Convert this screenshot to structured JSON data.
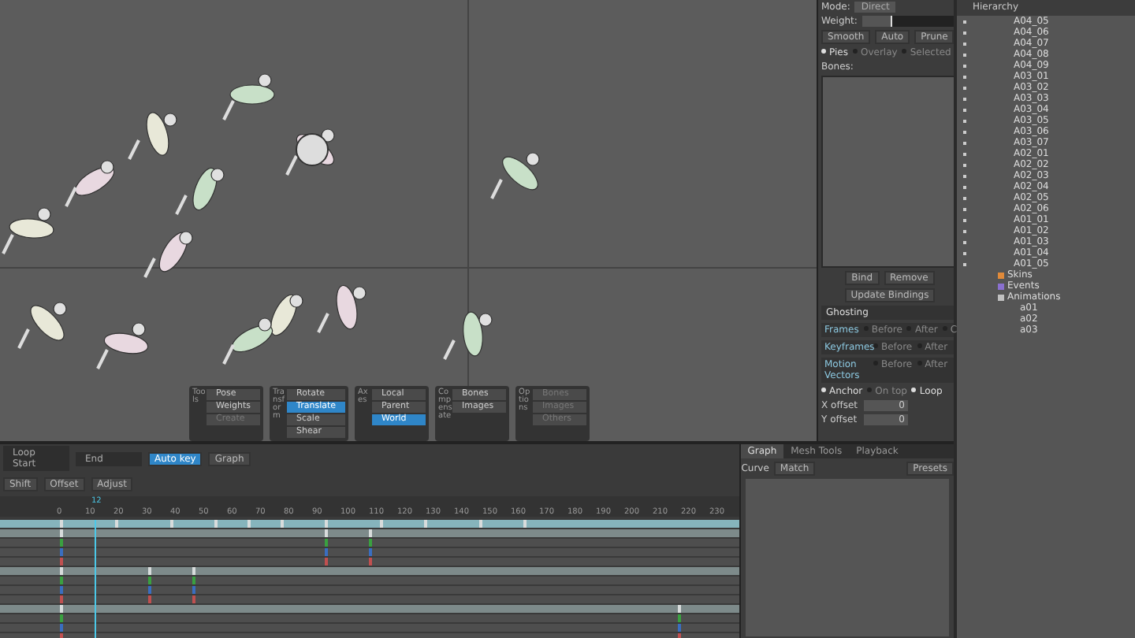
{
  "mesh_panel": {
    "mode_label": "Mode:",
    "mode_value": "Direct",
    "weight_label": "Weight:",
    "weight": {
      "level": 0.3
    },
    "buttons": [
      "Smooth",
      "Auto",
      "Prune"
    ],
    "options": [
      {
        "label": "Pies",
        "checked": true
      },
      {
        "label": "Overlay",
        "checked": false
      },
      {
        "label": "Selected",
        "checked": false
      }
    ],
    "bones_label": "Bones:",
    "actions": [
      "Bind",
      "Remove"
    ],
    "update_button": "Update Bindings"
  },
  "ghosting": {
    "title": "Ghosting",
    "rows": [
      {
        "label": "Frames",
        "options": [
          {
            "label": "Before",
            "checked": false
          },
          {
            "label": "After",
            "checked": false
          },
          {
            "label": "C",
            "checked": false
          }
        ]
      },
      {
        "label": "Keyframes",
        "options": [
          {
            "label": "Before",
            "checked": false
          },
          {
            "label": "After",
            "checked": false
          }
        ]
      },
      {
        "label": "Motion Vectors",
        "options": [
          {
            "label": "Before",
            "checked": false
          },
          {
            "label": "After",
            "checked": false
          }
        ]
      }
    ],
    "flags": [
      {
        "label": "Anchor",
        "checked": true
      },
      {
        "label": "On top",
        "checked": false
      },
      {
        "label": "Loop",
        "checked": true
      }
    ],
    "offsets": [
      {
        "label": "X offset",
        "value": "0"
      },
      {
        "label": "Y offset",
        "value": "0"
      }
    ]
  },
  "toolbar": [
    {
      "title": "Tools",
      "items": [
        {
          "label": "Pose",
          "selected": false,
          "disabled": false
        },
        {
          "label": "Weights",
          "selected": false,
          "disabled": false
        },
        {
          "label": "Create",
          "selected": false,
          "disabled": true
        }
      ]
    },
    {
      "title": "Transform",
      "items": [
        {
          "label": "Rotate",
          "selected": false,
          "disabled": false
        },
        {
          "label": "Translate",
          "selected": true,
          "disabled": false
        },
        {
          "label": "Scale",
          "selected": false,
          "disabled": false
        },
        {
          "label": "Shear",
          "selected": false,
          "disabled": false
        }
      ]
    },
    {
      "title": "Axes",
      "items": [
        {
          "label": "Local",
          "selected": false,
          "disabled": false
        },
        {
          "label": "Parent",
          "selected": false,
          "disabled": false
        },
        {
          "label": "World",
          "selected": true,
          "disabled": false
        }
      ]
    },
    {
      "title": "Compensate",
      "items": [
        {
          "label": "Bones",
          "selected": false,
          "disabled": false
        },
        {
          "label": "Images",
          "selected": false,
          "disabled": false
        }
      ]
    },
    {
      "title": "Options",
      "items": [
        {
          "label": "Bones",
          "selected": false,
          "disabled": true
        },
        {
          "label": "Images",
          "selected": false,
          "disabled": true
        },
        {
          "label": "Others",
          "selected": false,
          "disabled": true
        }
      ]
    }
  ],
  "hierarchy": {
    "title": "Hierarchy",
    "items": [
      "A04_05",
      "A04_06",
      "A04_07",
      "A04_08",
      "A04_09",
      "A03_01",
      "A03_02",
      "A03_03",
      "A03_04",
      "A03_05",
      "A03_06",
      "A03_07",
      "A02_01",
      "A02_02",
      "A02_03",
      "A02_04",
      "A02_05",
      "A02_06",
      "A01_01",
      "A01_02",
      "A01_03",
      "A01_04",
      "A01_05"
    ],
    "sections": [
      {
        "kind": "skins",
        "label": "Skins"
      },
      {
        "kind": "events",
        "label": "Events"
      },
      {
        "kind": "animations",
        "label": "Animations",
        "children": [
          "a01",
          "a02",
          "a03"
        ]
      }
    ]
  },
  "timeline": {
    "loop_start": "Loop Start",
    "end": "End",
    "auto_key": {
      "label": "Auto key",
      "on": true
    },
    "graph_button": "Graph",
    "tools": [
      "Shift",
      "Offset",
      "Adjust"
    ],
    "ruler": [
      "0",
      "10",
      "20",
      "30",
      "40",
      "50",
      "60",
      "70",
      "80",
      "90",
      "100",
      "110",
      "120",
      "130",
      "140",
      "150",
      "160",
      "170",
      "180",
      "190",
      "200",
      "210",
      "220",
      "230"
    ],
    "current_frame": "12",
    "rows": [
      {
        "kind": "bone"
      },
      {
        "kind": "attachment"
      },
      {
        "kind": "channel"
      },
      {
        "kind": "channel"
      },
      {
        "kind": "channel"
      },
      {
        "kind": "attachment"
      },
      {
        "kind": "channel"
      },
      {
        "kind": "channel"
      },
      {
        "kind": "channel"
      },
      {
        "kind": "attachment"
      },
      {
        "kind": "channel"
      },
      {
        "kind": "channel"
      },
      {
        "kind": "channel"
      }
    ]
  },
  "graph_panel": {
    "tabs": [
      {
        "label": "Graph",
        "selected": true
      },
      {
        "label": "Mesh Tools",
        "selected": false
      },
      {
        "label": "Playback",
        "selected": false
      }
    ],
    "curve_label": "Curve",
    "match": "Match",
    "presets": "Presets"
  }
}
